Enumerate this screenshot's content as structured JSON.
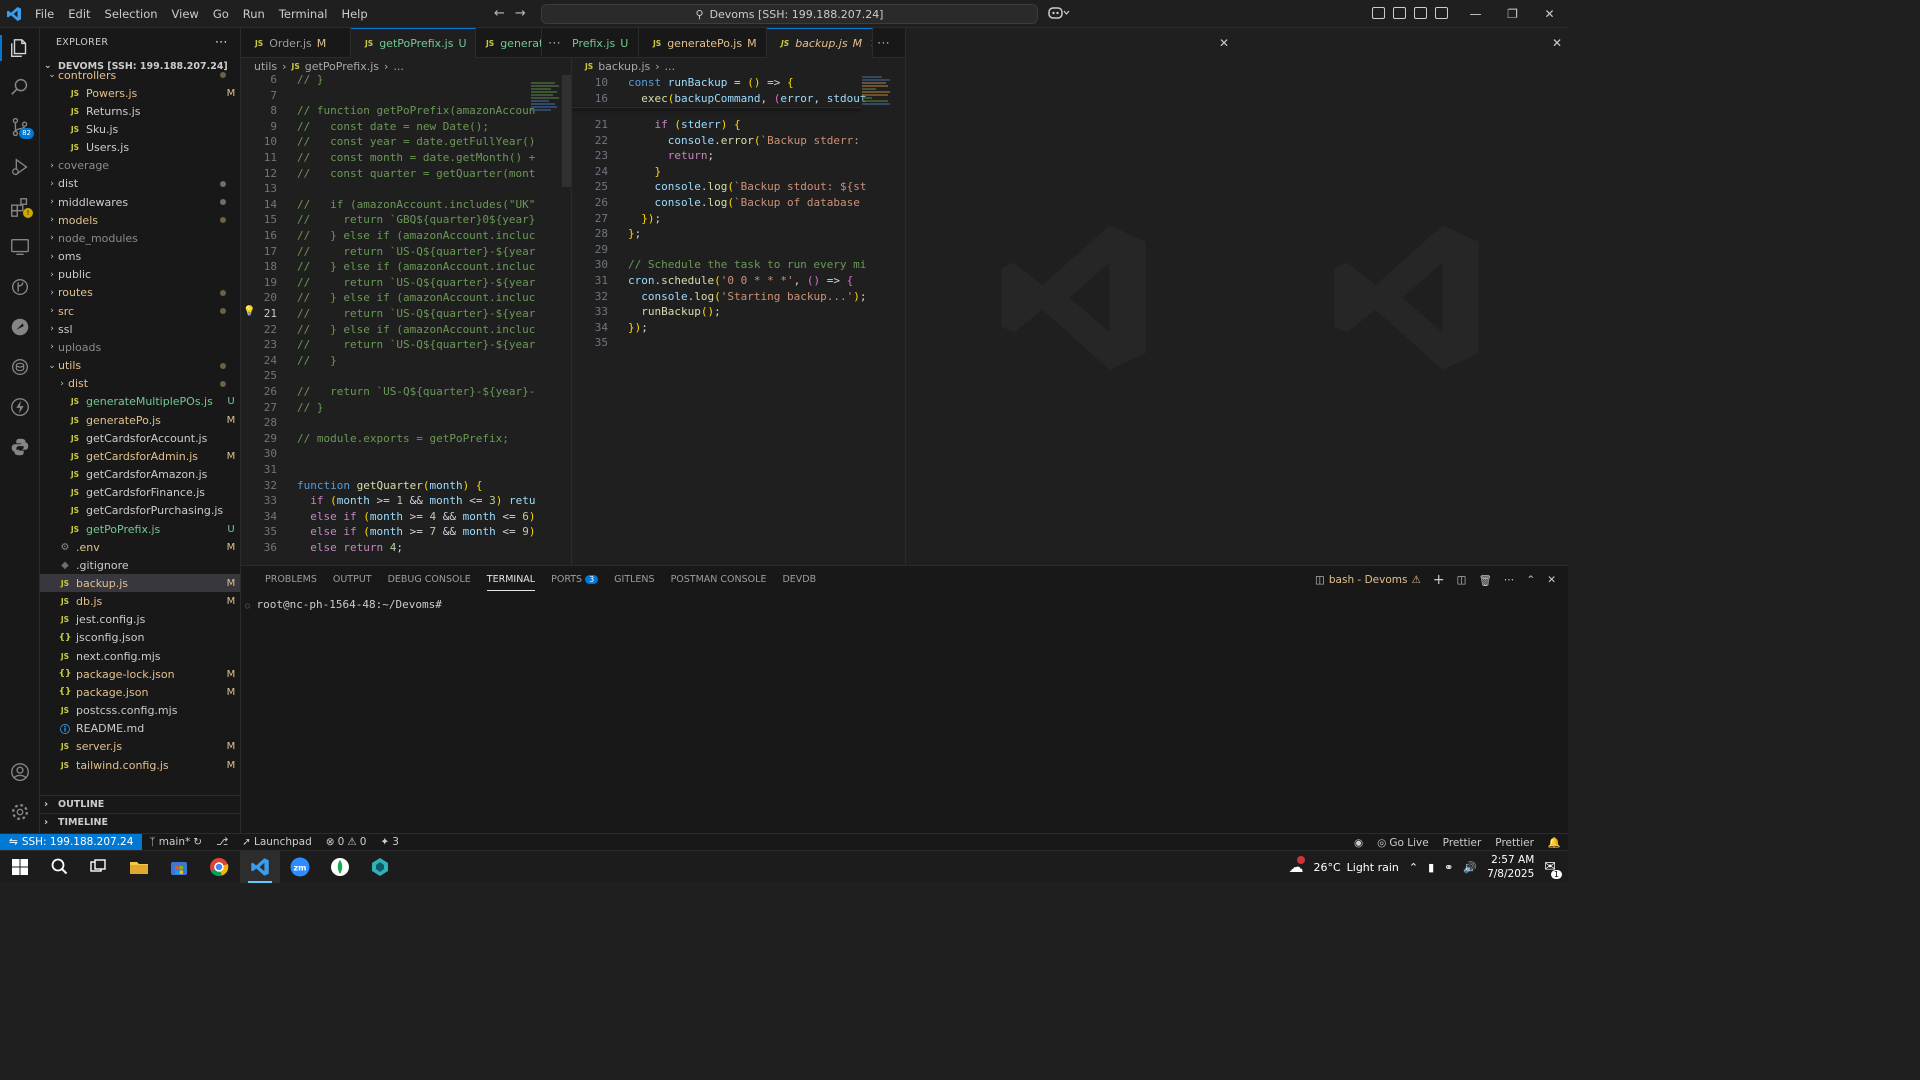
{
  "titlebar": {
    "menu": [
      "File",
      "Edit",
      "Selection",
      "View",
      "Go",
      "Run",
      "Terminal",
      "Help"
    ],
    "command_center": "Devoms [SSH: 199.188.207.24]"
  },
  "activity": {
    "scm_badge": "82"
  },
  "explorer": {
    "header": "EXPLORER",
    "root": "DEVOMS [SSH: 199.188.207.24]",
    "outline": "OUTLINE",
    "timeline": "TIMELINE",
    "rows": [
      {
        "name": "controllers",
        "kind": "folder-open",
        "indent": 1,
        "color": "mod",
        "mark": "dot"
      },
      {
        "name": "Powers.js",
        "kind": "js",
        "indent": 2,
        "color": "mod",
        "mark": "M"
      },
      {
        "name": "Returns.js",
        "kind": "js",
        "indent": 2,
        "color": "",
        "mark": ""
      },
      {
        "name": "Sku.js",
        "kind": "js",
        "indent": 2,
        "color": "",
        "mark": ""
      },
      {
        "name": "Users.js",
        "kind": "js",
        "indent": 2,
        "color": "",
        "mark": ""
      },
      {
        "name": "coverage",
        "kind": "folder",
        "indent": 1,
        "color": "dim",
        "mark": ""
      },
      {
        "name": "dist",
        "kind": "folder",
        "indent": 1,
        "color": "",
        "mark": "dot"
      },
      {
        "name": "middlewares",
        "kind": "folder",
        "indent": 1,
        "color": "",
        "mark": "dot"
      },
      {
        "name": "models",
        "kind": "folder",
        "indent": 1,
        "color": "mod",
        "mark": "dot"
      },
      {
        "name": "node_modules",
        "kind": "folder",
        "indent": 1,
        "color": "dim",
        "mark": ""
      },
      {
        "name": "oms",
        "kind": "folder",
        "indent": 1,
        "color": "",
        "mark": ""
      },
      {
        "name": "public",
        "kind": "folder",
        "indent": 1,
        "color": "",
        "mark": ""
      },
      {
        "name": "routes",
        "kind": "folder",
        "indent": 1,
        "color": "mod",
        "mark": "dot"
      },
      {
        "name": "src",
        "kind": "folder",
        "indent": 1,
        "color": "mod",
        "mark": "dot"
      },
      {
        "name": "ssl",
        "kind": "folder",
        "indent": 1,
        "color": "",
        "mark": ""
      },
      {
        "name": "uploads",
        "kind": "folder",
        "indent": 1,
        "color": "dim",
        "mark": ""
      },
      {
        "name": "utils",
        "kind": "folder-open",
        "indent": 1,
        "color": "mod",
        "mark": "dot"
      },
      {
        "name": "dist",
        "kind": "folder",
        "indent": 2,
        "color": "mod",
        "mark": "dot"
      },
      {
        "name": "generateMultiplePOs.js",
        "kind": "js",
        "indent": 2,
        "color": "unt",
        "mark": "U"
      },
      {
        "name": "generatePo.js",
        "kind": "js",
        "indent": 2,
        "color": "mod",
        "mark": "M"
      },
      {
        "name": "getCardsforAccount.js",
        "kind": "js",
        "indent": 2,
        "color": "",
        "mark": ""
      },
      {
        "name": "getCardsforAdmin.js",
        "kind": "js",
        "indent": 2,
        "color": "mod",
        "mark": "M"
      },
      {
        "name": "getCardsforAmazon.js",
        "kind": "js",
        "indent": 2,
        "color": "",
        "mark": ""
      },
      {
        "name": "getCardsforFinance.js",
        "kind": "js",
        "indent": 2,
        "color": "",
        "mark": ""
      },
      {
        "name": "getCardsforPurchasing.js",
        "kind": "js",
        "indent": 2,
        "color": "",
        "mark": ""
      },
      {
        "name": "getPoPrefix.js",
        "kind": "js",
        "indent": 2,
        "color": "unt",
        "mark": "U"
      },
      {
        "name": ".env",
        "kind": "gear",
        "indent": 1,
        "color": "mod",
        "mark": "M"
      },
      {
        "name": ".gitignore",
        "kind": "git",
        "indent": 1,
        "color": "",
        "mark": ""
      },
      {
        "name": "backup.js",
        "kind": "js",
        "indent": 1,
        "color": "mod",
        "mark": "M",
        "selected": true
      },
      {
        "name": "db.js",
        "kind": "js",
        "indent": 1,
        "color": "mod",
        "mark": "M"
      },
      {
        "name": "jest.config.js",
        "kind": "js",
        "indent": 1,
        "color": "",
        "mark": ""
      },
      {
        "name": "jsconfig.json",
        "kind": "json",
        "indent": 1,
        "color": "",
        "mark": ""
      },
      {
        "name": "next.config.mjs",
        "kind": "js",
        "indent": 1,
        "color": "",
        "mark": ""
      },
      {
        "name": "package-lock.json",
        "kind": "json",
        "indent": 1,
        "color": "mod",
        "mark": "M"
      },
      {
        "name": "package.json",
        "kind": "json",
        "indent": 1,
        "color": "mod",
        "mark": "M"
      },
      {
        "name": "postcss.config.mjs",
        "kind": "js",
        "indent": 1,
        "color": "",
        "mark": ""
      },
      {
        "name": "README.md",
        "kind": "info",
        "indent": 1,
        "color": "",
        "mark": ""
      },
      {
        "name": "server.js",
        "kind": "js",
        "indent": 1,
        "color": "mod",
        "mark": "M"
      },
      {
        "name": "tailwind.config.js",
        "kind": "js",
        "indent": 1,
        "color": "mod",
        "mark": "M"
      }
    ]
  },
  "tabs": {
    "left": [
      {
        "label": "Order.js",
        "status": "M",
        "active": false
      },
      {
        "label": "getPoPrefix.js",
        "status": "U",
        "active": true
      },
      {
        "label": "generat",
        "status": "",
        "active": false
      }
    ],
    "right": [
      {
        "label": "Prefix.js",
        "status": "U",
        "active": false
      },
      {
        "label": "generatePo.js",
        "status": "M",
        "active": false
      },
      {
        "label": "backup.js",
        "status": "M",
        "active": true
      }
    ],
    "js_icon": "JS"
  },
  "editor_left": {
    "breadcrumb_folder": "utils",
    "breadcrumb_file": "getPoPrefix.js",
    "breadcrumb_more": "...",
    "lines": [
      {
        "n": "6",
        "t": "// }"
      },
      {
        "n": "7",
        "t": ""
      },
      {
        "n": "8",
        "t": "// function getPoPrefix(amazonAccoun"
      },
      {
        "n": "9",
        "t": "//   const date = new Date();"
      },
      {
        "n": "10",
        "t": "//   const year = date.getFullYear()"
      },
      {
        "n": "11",
        "t": "//   const month = date.getMonth() +"
      },
      {
        "n": "12",
        "t": "//   const quarter = getQuarter(mont"
      },
      {
        "n": "13",
        "t": ""
      },
      {
        "n": "14",
        "t": "//   if (amazonAccount.includes(\"UK\""
      },
      {
        "n": "15",
        "t": "//     return `GBQ${quarter}0${year}"
      },
      {
        "n": "16",
        "t": "//   } else if (amazonAccount.incluc"
      },
      {
        "n": "17",
        "t": "//     return `US-Q${quarter}-${year"
      },
      {
        "n": "18",
        "t": "//   } else if (amazonAccount.incluc"
      },
      {
        "n": "19",
        "t": "//     return `US-Q${quarter}-${year"
      },
      {
        "n": "20",
        "t": "//   } else if (amazonAccount.incluc"
      },
      {
        "n": "21",
        "t": "//     return `US-Q${quarter}-${year"
      },
      {
        "n": "22",
        "t": "//   } else if (amazonAccount.incluc"
      },
      {
        "n": "23",
        "t": "//     return `US-Q${quarter}-${year"
      },
      {
        "n": "24",
        "t": "//   }"
      },
      {
        "n": "25",
        "t": ""
      },
      {
        "n": "26",
        "t": "//   return `US-Q${quarter}-${year}-"
      },
      {
        "n": "27",
        "t": "// }"
      },
      {
        "n": "28",
        "t": ""
      },
      {
        "n": "29",
        "t": "// module.exports = getPoPrefix;"
      },
      {
        "n": "30",
        "t": ""
      },
      {
        "n": "31",
        "t": ""
      },
      {
        "n": "32",
        "t": "function getQuarter(month) {"
      },
      {
        "n": "33",
        "t": "  if (month >= 1 && month <= 3) retu"
      },
      {
        "n": "34",
        "t": "  else if (month >= 4 && month <= 6)"
      },
      {
        "n": "35",
        "t": "  else if (month >= 7 && month <= 9)"
      },
      {
        "n": "36",
        "t": "  else return 4;"
      }
    ]
  },
  "editor_right": {
    "breadcrumb_file": "backup.js",
    "breadcrumb_more": "...",
    "sticky": [
      {
        "n": "10",
        "t": "const runBackup = () => {"
      },
      {
        "n": "16",
        "t": "  exec(backupCommand, (error, stdout"
      }
    ],
    "lines": [
      {
        "n": "21",
        "t": "    if (stderr) {"
      },
      {
        "n": "22",
        "t": "      console.error(`Backup stderr:"
      },
      {
        "n": "23",
        "t": "      return;"
      },
      {
        "n": "24",
        "t": "    }"
      },
      {
        "n": "25",
        "t": "    console.log(`Backup stdout: ${st"
      },
      {
        "n": "26",
        "t": "    console.log(`Backup of database"
      },
      {
        "n": "27",
        "t": "  });"
      },
      {
        "n": "28",
        "t": "};"
      },
      {
        "n": "29",
        "t": ""
      },
      {
        "n": "30",
        "t": "// Schedule the task to run every mi"
      },
      {
        "n": "31",
        "t": "cron.schedule('0 0 * * *', () => {"
      },
      {
        "n": "32",
        "t": "  console.log('Starting backup...');"
      },
      {
        "n": "33",
        "t": "  runBackup();"
      },
      {
        "n": "34",
        "t": "});"
      },
      {
        "n": "35",
        "t": ""
      }
    ]
  },
  "panel": {
    "tabs": [
      "PROBLEMS",
      "OUTPUT",
      "DEBUG CONSOLE",
      "TERMINAL",
      "PORTS",
      "GITLENS",
      "POSTMAN CONSOLE",
      "DEVDB"
    ],
    "active_tab": "TERMINAL",
    "ports_badge": "3",
    "terminal_name": "bash - Devoms",
    "prompt": "root@nc-ph-1564-48:~/Devoms#"
  },
  "statusbar": {
    "remote": "SSH: 199.188.207.24",
    "branch": "main*",
    "launchpad": "Launchpad",
    "errors": "0",
    "warnings": "0",
    "ports": "3",
    "golive": "Go Live",
    "prettier1": "Prettier",
    "prettier2": "Prettier"
  },
  "taskbar": {
    "weather_temp": "26°C",
    "weather_desc": "Light rain",
    "time": "2:57 AM",
    "date": "7/8/2025",
    "notif_badge": "1"
  },
  "colors": {
    "accent": "#0078d4",
    "modified": "#e2c08d",
    "untracked": "#73c991"
  }
}
